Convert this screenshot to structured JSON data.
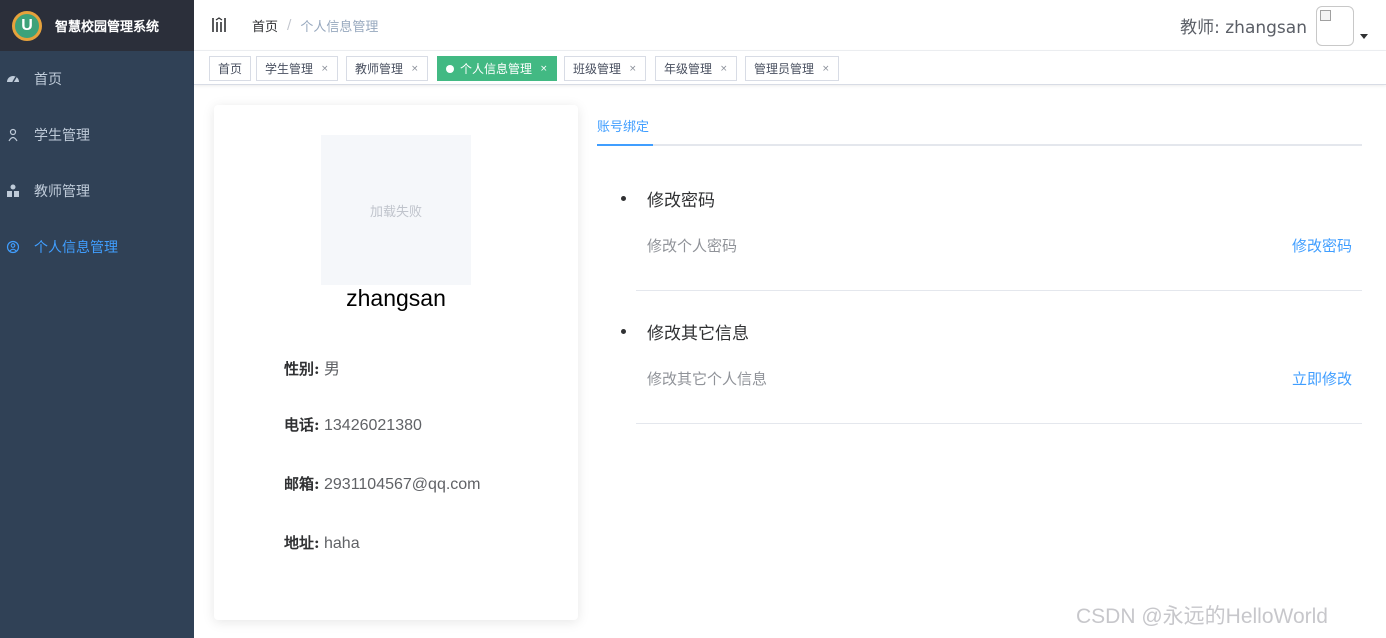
{
  "app": {
    "title": "智慧校园管理系统",
    "logo_letter": "U",
    "logo_icon": "brand-u-logo-icon"
  },
  "sidebar": {
    "items": [
      {
        "label": "首页",
        "icon": "dashboard-icon",
        "active": false
      },
      {
        "label": "学生管理",
        "icon": "user-icon",
        "active": false
      },
      {
        "label": "教师管理",
        "icon": "peoples-icon",
        "active": false
      },
      {
        "label": "个人信息管理",
        "icon": "user-circle-icon",
        "active": true
      }
    ]
  },
  "header": {
    "breadcrumb": {
      "home": "首页",
      "separator": "/",
      "current": "个人信息管理"
    },
    "user_label": "教师: zhangsan"
  },
  "tags": [
    {
      "label": "首页",
      "closable": false,
      "active": false
    },
    {
      "label": "学生管理",
      "closable": true,
      "active": false
    },
    {
      "label": "教师管理",
      "closable": true,
      "active": false
    },
    {
      "label": "个人信息管理",
      "closable": true,
      "active": true
    },
    {
      "label": "班级管理",
      "closable": true,
      "active": false
    },
    {
      "label": "年级管理",
      "closable": true,
      "active": false
    },
    {
      "label": "管理员管理",
      "closable": true,
      "active": false
    }
  ],
  "tag_close_glyph": "×",
  "profile": {
    "avatar_error": "加载失败",
    "name": "zhangsan",
    "fields": [
      {
        "label": "性别:",
        "value": "男"
      },
      {
        "label": "电话:",
        "value": "13426021380"
      },
      {
        "label": "邮箱:",
        "value": "2931104567@qq.com"
      },
      {
        "label": "地址:",
        "value": "haha"
      }
    ]
  },
  "account": {
    "tab_label": "账号绑定",
    "items": [
      {
        "title": "修改密码",
        "description": "修改个人密码",
        "action": "修改密码"
      },
      {
        "title": "修改其它信息",
        "description": "修改其它个人信息",
        "action": "立即修改"
      }
    ]
  },
  "watermark": "CSDN @永远的HelloWorld",
  "colors": {
    "sidebar_bg": "#304156",
    "logo_bar_bg": "#2b2f3a",
    "active_menu": "#409eff",
    "active_tag": "#42b983",
    "link": "#409eff"
  }
}
